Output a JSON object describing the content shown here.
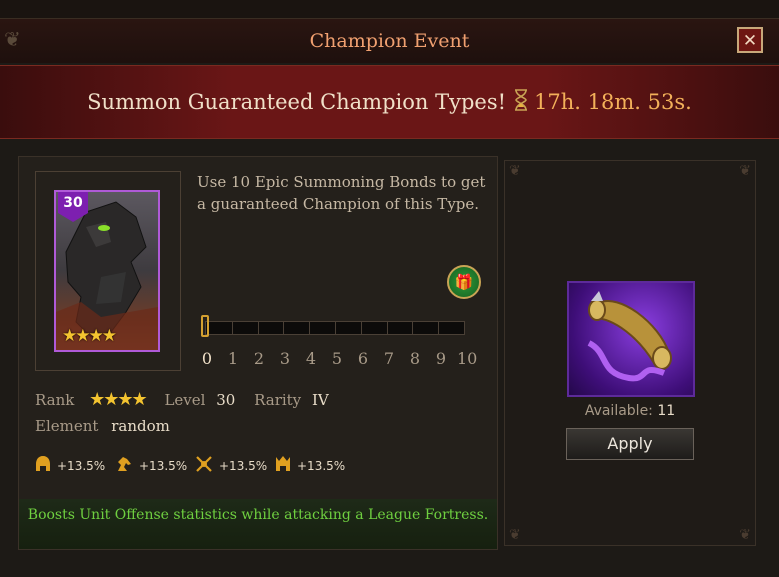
{
  "dialog": {
    "title": "Champion Event",
    "close_label": "✕"
  },
  "banner": {
    "text": "Summon Guaranteed Champion Types!",
    "timer": "17h. 18m. 53s."
  },
  "champion": {
    "level": "30",
    "card_stars": "★★★★",
    "description": "Use 10 Epic Summoning Bonds to get a guaranteed Champion of this Type.",
    "rank_label": "Rank",
    "rank_stars": "★★★★",
    "level_label": "Level",
    "level_value": "30",
    "rarity_label": "Rarity",
    "rarity_value": "IV",
    "element_label": "Element",
    "element_value": "random"
  },
  "progress": {
    "current": 0,
    "max": 10,
    "ticks": [
      "0",
      "1",
      "2",
      "3",
      "4",
      "5",
      "6",
      "7",
      "8",
      "9",
      "10"
    ]
  },
  "boosts": [
    {
      "icon": "helmet-icon",
      "value": "+13.5%"
    },
    {
      "icon": "horse-icon",
      "value": "+13.5%"
    },
    {
      "icon": "crossed-swords-icon",
      "value": "+13.5%"
    },
    {
      "icon": "crown-helmet-icon",
      "value": "+13.5%"
    }
  ],
  "footer_note": "Boosts Unit Offense statistics while attacking a League Fortress.",
  "item": {
    "name_icon": "summoning-scroll-icon",
    "available_label": "Available:",
    "available_value": "11",
    "apply_label": "Apply"
  },
  "colors": {
    "accent": "#f0a070",
    "timer": "#f3b15a",
    "note_green": "#6fd040",
    "star_gold": "#f4c430"
  }
}
